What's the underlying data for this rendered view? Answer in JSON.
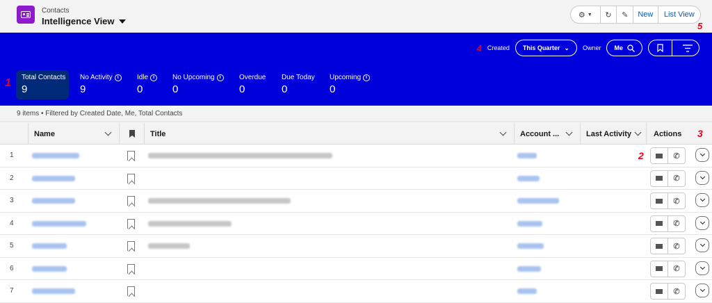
{
  "header": {
    "object_label": "Contacts",
    "view_title": "Intelligence View",
    "buttons": {
      "new": "New",
      "list_view": "List View"
    }
  },
  "markers": [
    "1",
    "2",
    "3",
    "4",
    "5"
  ],
  "filters": {
    "created_label": "Created",
    "created_value": "This Quarter",
    "owner_label": "Owner",
    "owner_value": "Me"
  },
  "metrics": [
    {
      "label": "Total Contacts",
      "value": "9",
      "info": false
    },
    {
      "label": "No Activity",
      "value": "9",
      "info": true
    },
    {
      "label": "Idle",
      "value": "0",
      "info": true
    },
    {
      "label": "No Upcoming",
      "value": "0",
      "info": true
    },
    {
      "label": "Overdue",
      "value": "0",
      "info": false
    },
    {
      "label": "Due Today",
      "value": "0",
      "info": false
    },
    {
      "label": "Upcoming",
      "value": "0",
      "info": true
    }
  ],
  "summary": "9 items • Filtered by Created Date, Me, Total Contacts",
  "columns": {
    "name": "Name",
    "title": "Title",
    "account": "Account ...",
    "last_activity": "Last Activity",
    "actions": "Actions"
  },
  "rows": [
    "1",
    "2",
    "3",
    "4",
    "5",
    "6",
    "7"
  ],
  "colors": {
    "band": "#0000db",
    "active_metric": "#002a78",
    "accent": "#0b5cab",
    "app_icon": "#8d1bcb",
    "marker": "#ea001e"
  }
}
